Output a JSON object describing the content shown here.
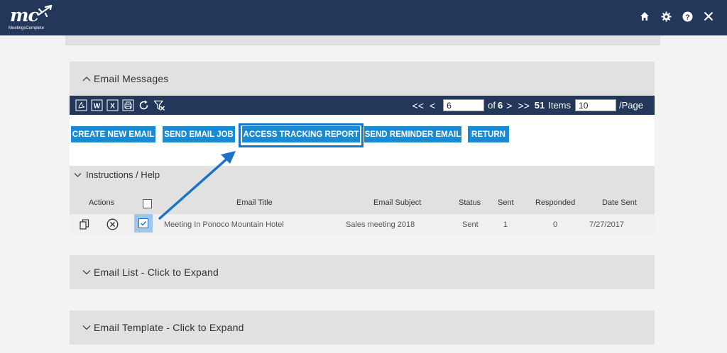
{
  "header": {
    "logo_mark": "mc",
    "logo_subtitle": "MeetingsComplete",
    "icons": [
      "home-icon",
      "gear-icon",
      "help-icon",
      "close-icon"
    ],
    "bar_color": "#22375a"
  },
  "email_messages": {
    "title": "Email Messages",
    "toolbar": {
      "icons": [
        "pdf-export-icon",
        "word-export-icon",
        "excel-export-icon",
        "print-icon",
        "refresh-icon",
        "clear-filter-icon"
      ],
      "first_page": "<<",
      "prev_page": "<",
      "page_value": "6",
      "of_label": "of",
      "total_pages": "6",
      "next_page": ">",
      "last_page": ">>",
      "items_count": "51",
      "items_label": "Items",
      "page_size": "10",
      "per_page_label": "/Page"
    },
    "buttons": {
      "create": "CREATE NEW EMAIL",
      "send": "SEND EMAIL JOB",
      "access": "ACCESS TRACKING REPORT",
      "reminder": "SEND REMINDER EMAIL",
      "return": "RETURN"
    },
    "button_color": "#1a8ad2",
    "help_title": "Instructions / Help",
    "table": {
      "headers": {
        "actions": "Actions",
        "email_title": "Email Title",
        "email_subject": "Email Subject",
        "status": "Status",
        "sent": "Sent",
        "responded": "Responded",
        "date_sent": "Date Sent"
      },
      "rows": [
        {
          "email_title": "Meeting In Ponoco Mountain Hotel",
          "email_subject": "Sales meeting 2018",
          "status": "Sent",
          "sent": "1",
          "responded": "0",
          "date_sent": "7/27/2017",
          "checked": true
        }
      ]
    }
  },
  "email_list": {
    "title": "Email List - Click to Expand"
  },
  "email_template": {
    "title": "Email Template - Click to Expand"
  }
}
